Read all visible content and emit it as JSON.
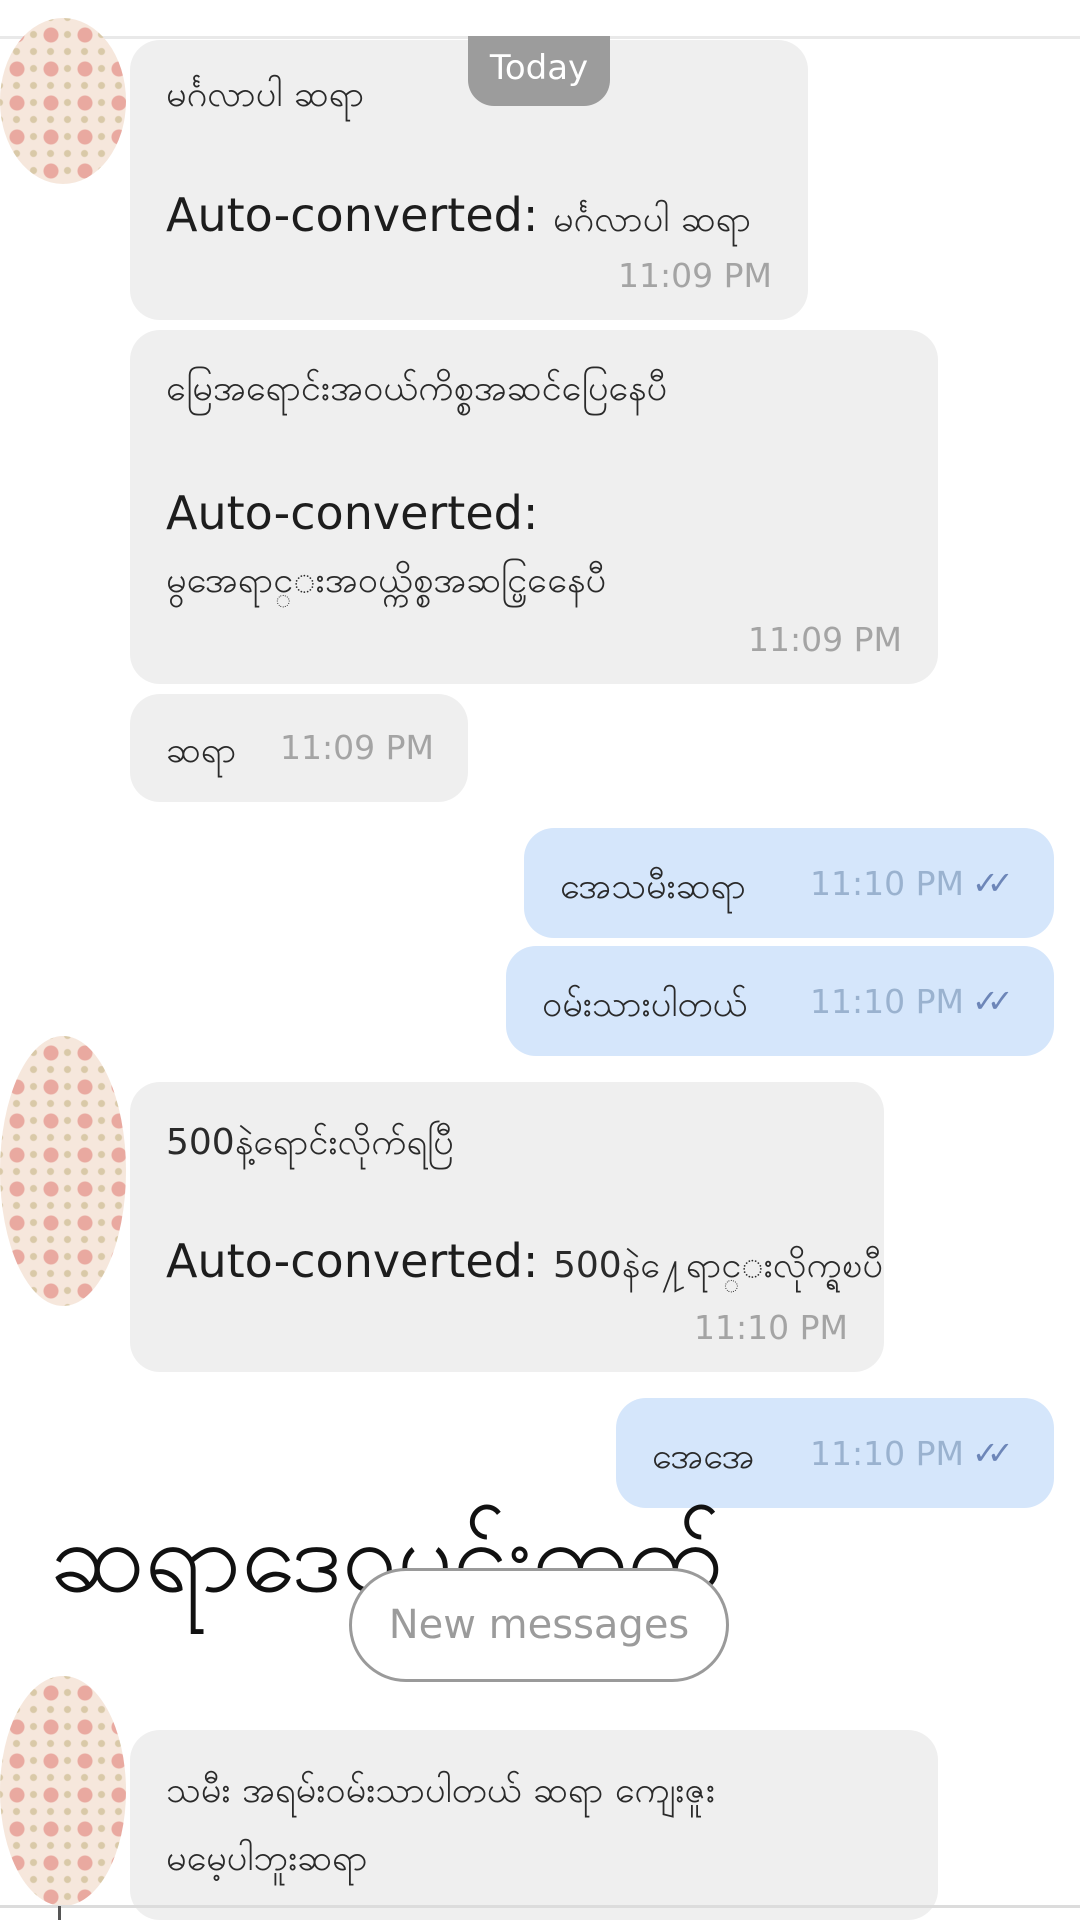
{
  "date_separator": "Today",
  "messages": [
    {
      "text": "မင်္ဂလာပါ ဆရာ",
      "auto_label": "Auto-converted:",
      "converted": "မင်္ဂလာပါ ဆရာ",
      "time": "11:09 PM"
    },
    {
      "text": "မြေအရောင်းအဝယ်ကိစ္စအဆင်ပြေနေပီ",
      "auto_label": "Auto-converted:",
      "converted": "မွအေရာင္းအ၀ယ္ကိစ္စအဆင္ပြနေေပီ",
      "time": "11:09 PM"
    },
    {
      "text": "ဆရာ",
      "time": "11:09 PM"
    },
    {
      "text": "အေသမီးဆရာ",
      "time": "11:10 PM",
      "status": "read"
    },
    {
      "text": "ဝမ်းသားပါတယ်",
      "time": "11:10 PM",
      "status": "read"
    },
    {
      "text": "500နဲ့ရောင်းလိုက်ရပြီ",
      "auto_label": "Auto-converted:",
      "converted": "500နဲ႔ေရာင္းလိုက္ရၿပီ",
      "time": "11:10 PM"
    },
    {
      "text": "အေအေ",
      "time": "11:10 PM",
      "status": "read"
    },
    {
      "text_line1": "သမီး အရမ်းဝမ်းသာပါတယ် ဆရာ ကျေးဇူး",
      "text_line2": "မမေ့ပါဘူးဆရာ"
    }
  ],
  "overlay_caption": "ဆရာဒေဝမင်းထက်",
  "new_messages_label": "New messages",
  "icons": {
    "read_receipt": "double-check-icon",
    "avatar": "avatar"
  },
  "colors": {
    "incoming_bubble": "#efefef",
    "outgoing_bubble": "#d5e6fb",
    "read_check": "#6d86b8"
  }
}
